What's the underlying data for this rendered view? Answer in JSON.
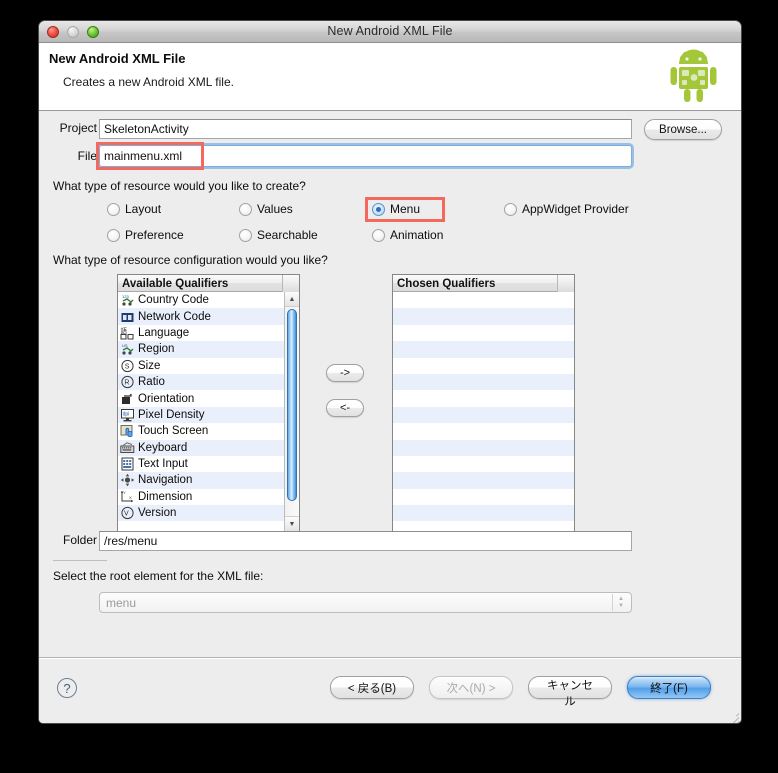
{
  "window": {
    "title": "New Android XML File",
    "traffic_lights": [
      "close-button",
      "minimize-button",
      "zoom-button"
    ]
  },
  "header": {
    "title": "New Android XML File",
    "subtitle": "Creates a new Android XML file.",
    "logo": "android-robot-logo",
    "logo_color": "#A4C639"
  },
  "form": {
    "project_label": "Project",
    "project_value": "SkeletonActivity",
    "browse_label": "Browse...",
    "file_label": "File",
    "file_value": "mainmenu.xml",
    "folder_label": "Folder",
    "folder_value": "/res/menu"
  },
  "resource_type": {
    "question": "What type of resource would you like to create?",
    "options": [
      {
        "label": "Layout",
        "selected": false
      },
      {
        "label": "Values",
        "selected": false
      },
      {
        "label": "Menu",
        "selected": true
      },
      {
        "label": "AppWidget Provider",
        "selected": false
      },
      {
        "label": "Preference",
        "selected": false
      },
      {
        "label": "Searchable",
        "selected": false
      },
      {
        "label": "Animation",
        "selected": false
      }
    ]
  },
  "configuration": {
    "question": "What type of resource configuration would you like?",
    "available_header": "Available Qualifiers",
    "chosen_header": "Chosen Qualifiers",
    "available": [
      {
        "label": "Country Code",
        "icon": "country-code-icon"
      },
      {
        "label": "Network Code",
        "icon": "network-code-icon"
      },
      {
        "label": "Language",
        "icon": "language-icon"
      },
      {
        "label": "Region",
        "icon": "region-icon"
      },
      {
        "label": "Size",
        "icon": "size-icon"
      },
      {
        "label": "Ratio",
        "icon": "ratio-icon"
      },
      {
        "label": "Orientation",
        "icon": "orientation-icon"
      },
      {
        "label": "Pixel Density",
        "icon": "pixel-density-icon"
      },
      {
        "label": "Touch Screen",
        "icon": "touch-screen-icon"
      },
      {
        "label": "Keyboard",
        "icon": "keyboard-icon"
      },
      {
        "label": "Text Input",
        "icon": "text-input-icon"
      },
      {
        "label": "Navigation",
        "icon": "navigation-icon"
      },
      {
        "label": "Dimension",
        "icon": "dimension-icon"
      },
      {
        "label": "Version",
        "icon": "version-icon"
      }
    ],
    "chosen": [],
    "add_button": "->",
    "remove_button": "<-"
  },
  "root_element": {
    "question": "Select the root element for the XML file:",
    "value": "menu",
    "enabled": false
  },
  "footer": {
    "help_label": "?",
    "buttons": [
      {
        "label": "< 戻る(B)",
        "state": "enabled"
      },
      {
        "label": "次へ(N) >",
        "state": "disabled"
      },
      {
        "label": "キャンセル",
        "state": "enabled"
      },
      {
        "label": "終了(F)",
        "state": "default"
      }
    ]
  },
  "annotations": {
    "color": "#f4695c",
    "boxes": [
      "file-field-highlight",
      "menu-radio-highlight"
    ]
  }
}
